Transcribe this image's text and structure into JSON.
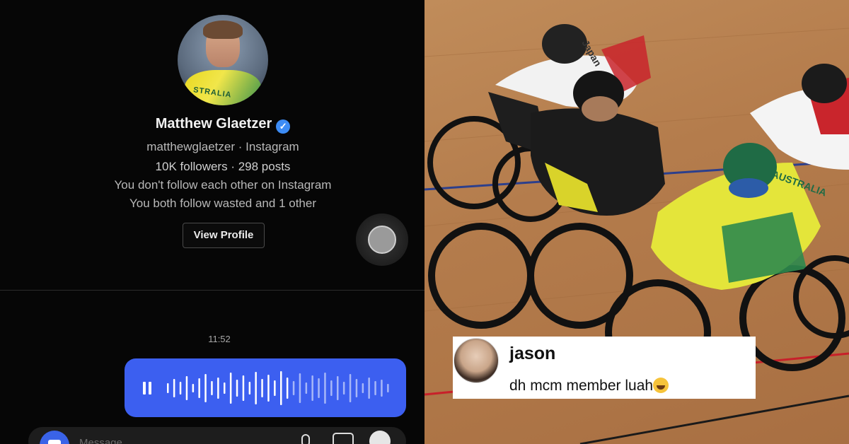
{
  "messenger": {
    "profile": {
      "name": "Matthew Glaetzer",
      "verified": true,
      "handle_line": "matthewglaetzer · Instagram",
      "stats_line": "10K followers · 298 posts",
      "follow_status": "You don't follow each other on Instagram",
      "mutuals": "You both follow wasted and 1 other",
      "view_profile_label": "View Profile",
      "avatar_jersey_text": "STRALIA"
    },
    "thread": {
      "timestamp": "11:52",
      "voice_message": {
        "state": "paused",
        "color": "#3c5ff0"
      }
    },
    "composer": {
      "placeholder": "Message"
    }
  },
  "comment": {
    "username": "jason",
    "text": "dh mcm member luah",
    "emoji": "face-with-tears-of-joy-icon"
  },
  "photo": {
    "jersey_labels": [
      "Japan",
      "AUSTRALIA"
    ]
  },
  "colors": {
    "accent_blue": "#3c5ff0",
    "verified_blue": "#3d8cf5",
    "track_wood": "#b47c4c"
  }
}
